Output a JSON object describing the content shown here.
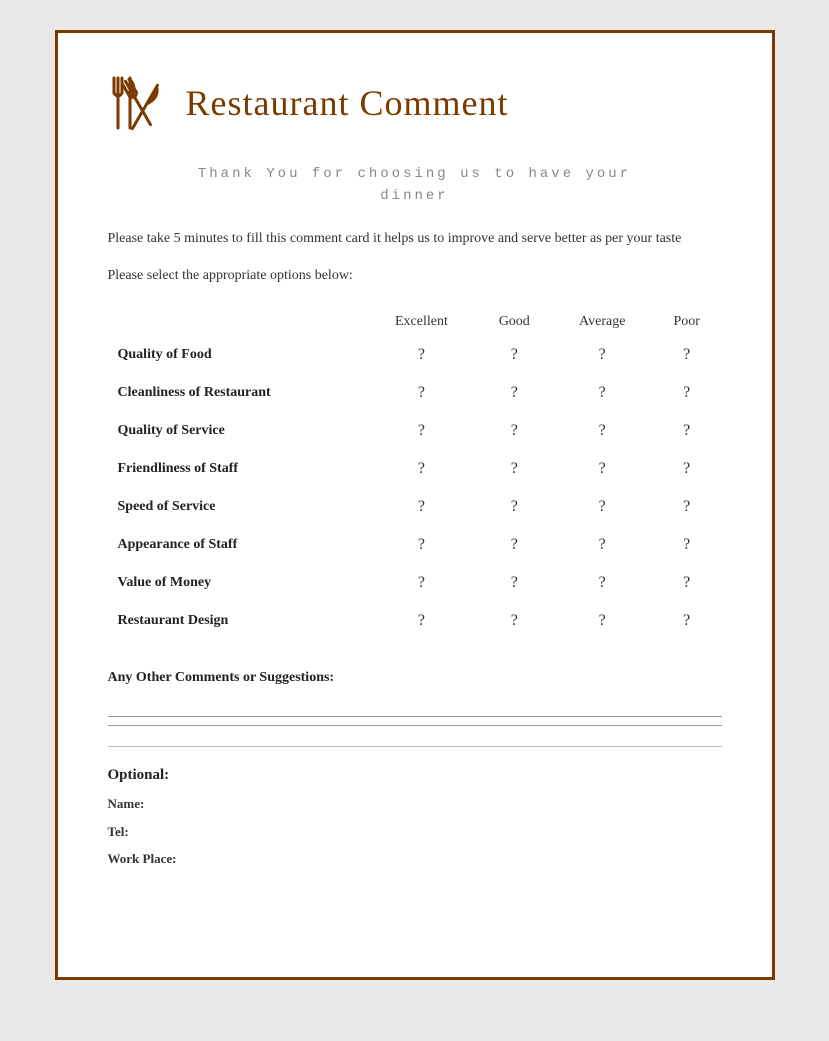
{
  "header": {
    "title": "Restaurant Comment",
    "icon_name": "fork-knife-icon"
  },
  "thank_you": {
    "line1": "Thank You for choosing us to have your",
    "line2": "dinner"
  },
  "description": "Please take 5 minutes to fill this comment card it helps us to improve and serve better as per your taste",
  "instruction": "Please select the appropriate options below:",
  "table": {
    "columns": [
      "",
      "Excellent",
      "Good",
      "Average",
      "Poor"
    ],
    "rows": [
      {
        "label": "Quality of Food",
        "excellent": "?",
        "good": "?",
        "average": "?",
        "poor": "?"
      },
      {
        "label": "Cleanliness of Restaurant",
        "excellent": "?",
        "good": "?",
        "average": "?",
        "poor": "?"
      },
      {
        "label": "Quality of Service",
        "excellent": "?",
        "good": "?",
        "average": "?",
        "poor": "?"
      },
      {
        "label": "Friendliness of Staff",
        "excellent": "?",
        "good": "?",
        "average": "?",
        "poor": "?"
      },
      {
        "label": "Speed of Service",
        "excellent": "?",
        "good": "?",
        "average": "?",
        "poor": "?"
      },
      {
        "label": "Appearance of Staff",
        "excellent": "?",
        "good": "?",
        "average": "?",
        "poor": "?"
      },
      {
        "label": "Value of Money",
        "excellent": "?",
        "good": "?",
        "average": "?",
        "poor": "?"
      },
      {
        "label": "Restaurant Design",
        "excellent": "?",
        "good": "?",
        "average": "?",
        "poor": "?"
      }
    ]
  },
  "comments": {
    "label": "Any Other Comments or Suggestions:"
  },
  "optional": {
    "title": "Optional:",
    "fields": [
      {
        "label": "Name:"
      },
      {
        "label": "Tel:"
      },
      {
        "label": "Work Place:"
      }
    ]
  }
}
